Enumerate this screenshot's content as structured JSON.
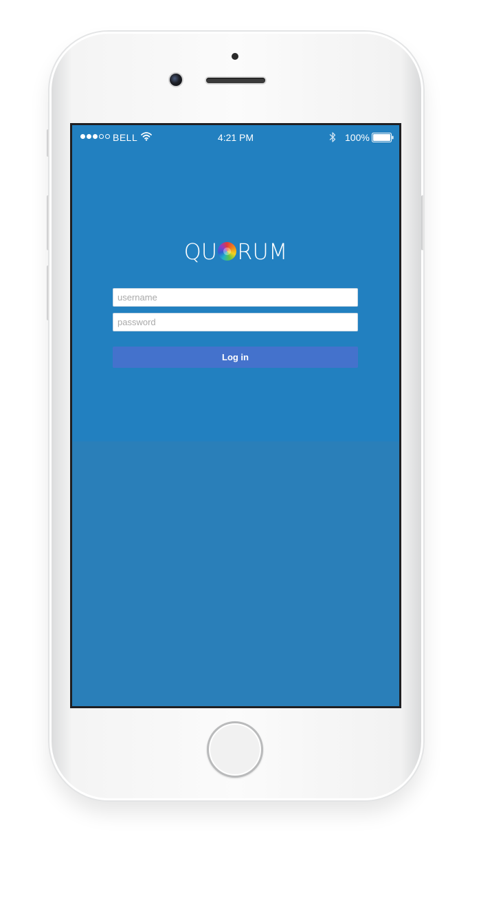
{
  "device": {
    "name": "iPhone",
    "color": "#f2f2f2"
  },
  "status_bar": {
    "signal_dots_filled": 3,
    "signal_dots_total": 5,
    "carrier": "BELL",
    "wifi_icon": "wifi-icon",
    "time": "4:21 PM",
    "bluetooth_icon": "bluetooth-icon",
    "battery_percent": "100%",
    "battery_level": 1.0
  },
  "app": {
    "logo_left": "QU",
    "logo_right": "RUM",
    "background_color": "#2280c0"
  },
  "login_form": {
    "username_placeholder": "username",
    "username_value": "",
    "password_placeholder": "password",
    "password_value": "",
    "login_button_label": "Log in",
    "button_color": "#4472cc"
  }
}
